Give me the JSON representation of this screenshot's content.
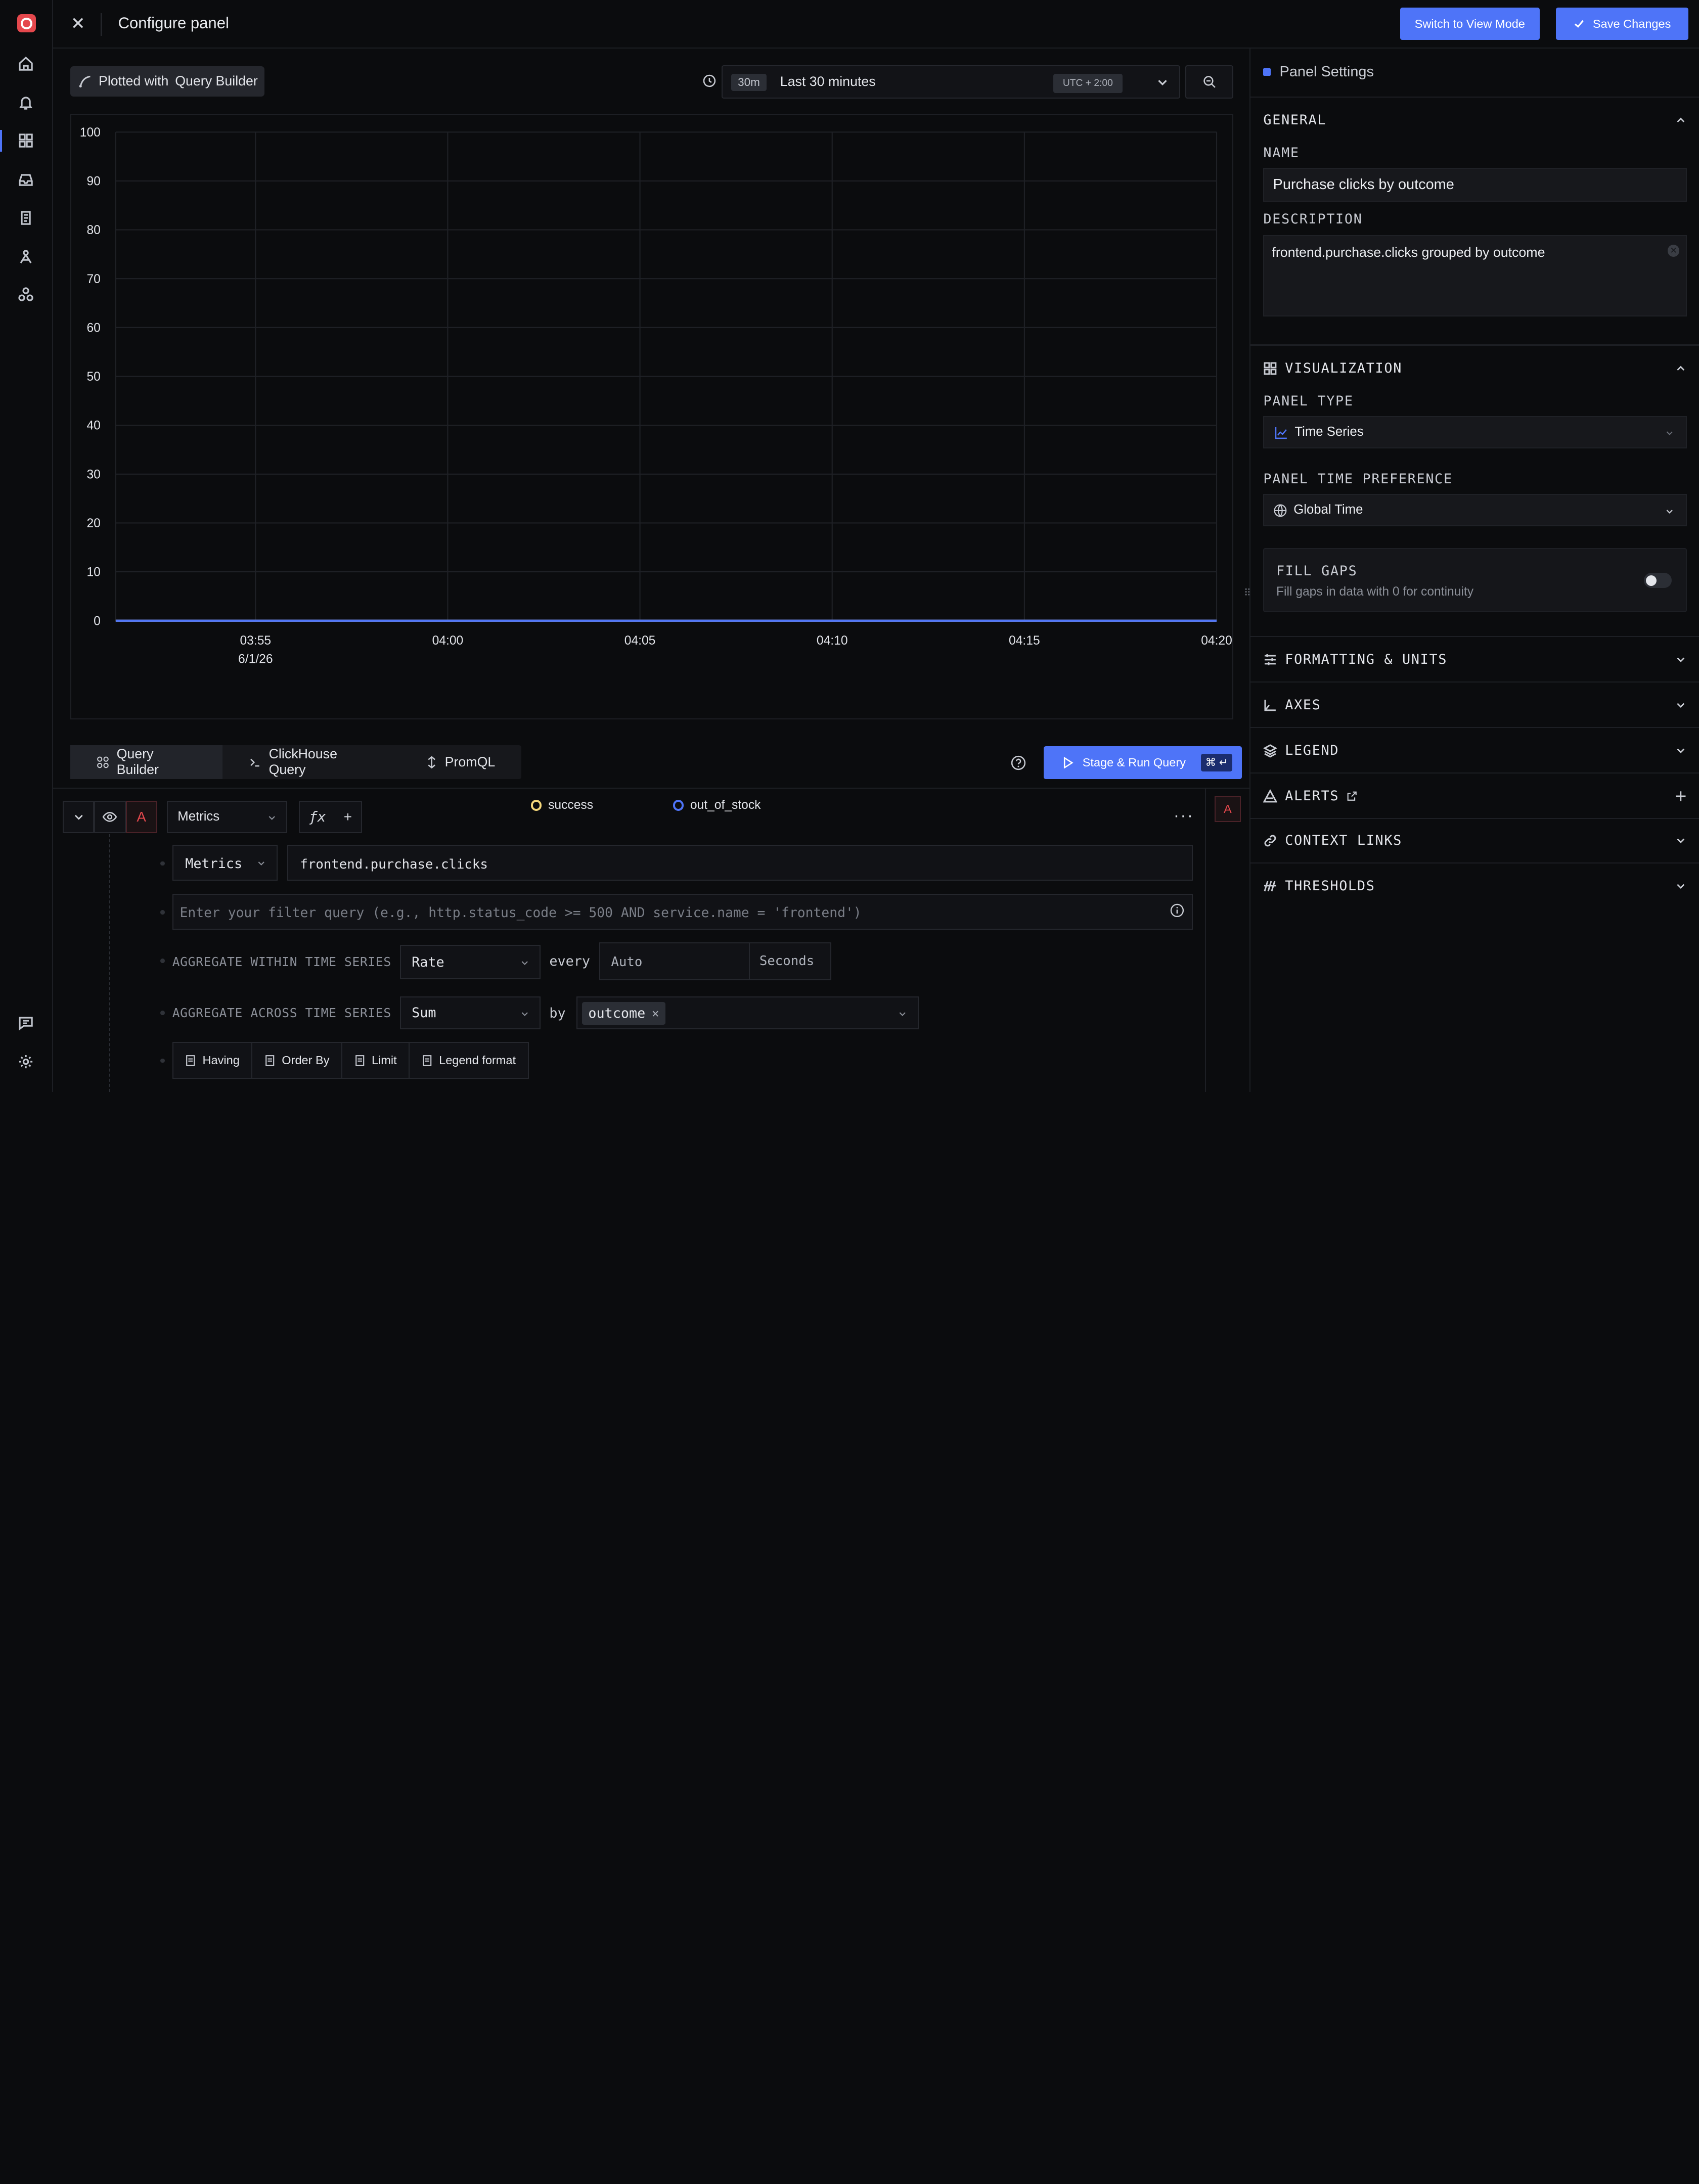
{
  "header": {
    "title": "Configure panel",
    "switch_view_label": "Switch to View Mode",
    "save_label": "Save Changes"
  },
  "chart_head": {
    "plotted_with": "Plotted with",
    "plotted_source": "Query Builder",
    "time_badge": "30m",
    "time_label": "Last 30 minutes",
    "timezone": "UTC + 2:00"
  },
  "chart_data": {
    "type": "line",
    "x": [
      "03:55",
      "04:00",
      "04:05",
      "04:10",
      "04:15",
      "04:20"
    ],
    "x_sub_label": "6/1/26",
    "ylim": [
      0,
      100
    ],
    "yticks": [
      0,
      10,
      20,
      30,
      40,
      50,
      60,
      70,
      80,
      90,
      100
    ],
    "grid": true,
    "legend_placement": "bottom-center",
    "series": [
      {
        "name": "success",
        "color": "#f5d77a",
        "values": [
          0,
          0,
          0,
          0,
          0,
          0
        ]
      },
      {
        "name": "out_of_stock",
        "color": "#4e74f8",
        "values": [
          0,
          0,
          0,
          0,
          0,
          0
        ]
      }
    ]
  },
  "query_tabs": [
    {
      "label": "Query Builder",
      "icon": "query-builder-icon"
    },
    {
      "label": "ClickHouse Query",
      "icon": "terminal-icon"
    },
    {
      "label": "PromQL",
      "icon": "promql-icon"
    }
  ],
  "run": {
    "label": "Stage & Run Query",
    "shortcut": "⌘ ↵"
  },
  "query": {
    "name": "A",
    "data_source": "Metrics",
    "metric_type": "Metrics",
    "metric_name": "frontend.purchase.clicks",
    "filter_placeholder": "Enter your filter query (e.g., http.status_code >= 500 AND service.name = 'frontend')",
    "aggregate_within_label": "AGGREGATE WITHIN TIME SERIES",
    "aggregate_within_value": "Rate",
    "every_label": "every",
    "every_value": "Auto",
    "every_unit": "Seconds",
    "aggregate_across_label": "AGGREGATE ACROSS TIME SERIES",
    "aggregate_across_value": "Sum",
    "by_label": "by",
    "group_by_tag": "outcome",
    "options": [
      "Having",
      "Order By",
      "Limit",
      "Legend format"
    ]
  },
  "panel_settings": {
    "title": "Panel Settings",
    "general_label": "GENERAL",
    "name_label": "NAME",
    "name_value": "Purchase clicks by outcome",
    "description_label": "DESCRIPTION",
    "description_value": "frontend.purchase.clicks grouped by outcome",
    "visualization_label": "VISUALIZATION",
    "panel_type_label": "PANEL TYPE",
    "panel_type_value": "Time Series",
    "time_pref_label": "PANEL TIME PREFERENCE",
    "time_pref_value": "Global Time",
    "fill_gaps_label": "FILL GAPS",
    "fill_gaps_desc": "Fill gaps in data with 0 for continuity",
    "fill_gaps_enabled": false,
    "sections": [
      {
        "label": "FORMATTING & UNITS",
        "icon": "sliders-icon"
      },
      {
        "label": "AXES",
        "icon": "axes-icon"
      },
      {
        "label": "LEGEND",
        "icon": "layers-icon"
      },
      {
        "label": "ALERTS",
        "icon": "alert-icon"
      },
      {
        "label": "CONTEXT LINKS",
        "icon": "link-icon"
      },
      {
        "label": "THRESHOLDS",
        "icon": "thresholds-icon"
      }
    ]
  },
  "colors": {
    "accent": "#4e74f8",
    "query_badge": "#e5484d",
    "background": "#0b0c0e"
  }
}
